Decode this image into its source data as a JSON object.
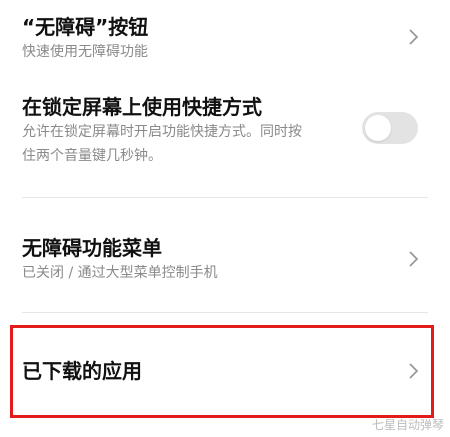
{
  "settings": {
    "accessibility_button": {
      "title": "“无障碍”按钮",
      "subtitle": "快速使用无障碍功能"
    },
    "lock_screen_shortcut": {
      "title": "在锁定屏幕上使用快捷方式",
      "subtitle_line1": "允许在锁定屏幕时开启功能快捷方式。同时按",
      "subtitle_line2": "住两个音量键几秒钟。",
      "toggle_on": false
    },
    "accessibility_menu": {
      "title": "无障碍功能菜单",
      "subtitle": "已关闭 / 通过大型菜单控制手机"
    },
    "downloaded_apps": {
      "title": "已下载的应用"
    }
  },
  "watermark": "七星自动弹琴",
  "colors": {
    "highlight_border": "#e21b1b",
    "toggle_off": "#e3e3e3"
  },
  "icons": {
    "chevron": "chevron-right-icon"
  }
}
